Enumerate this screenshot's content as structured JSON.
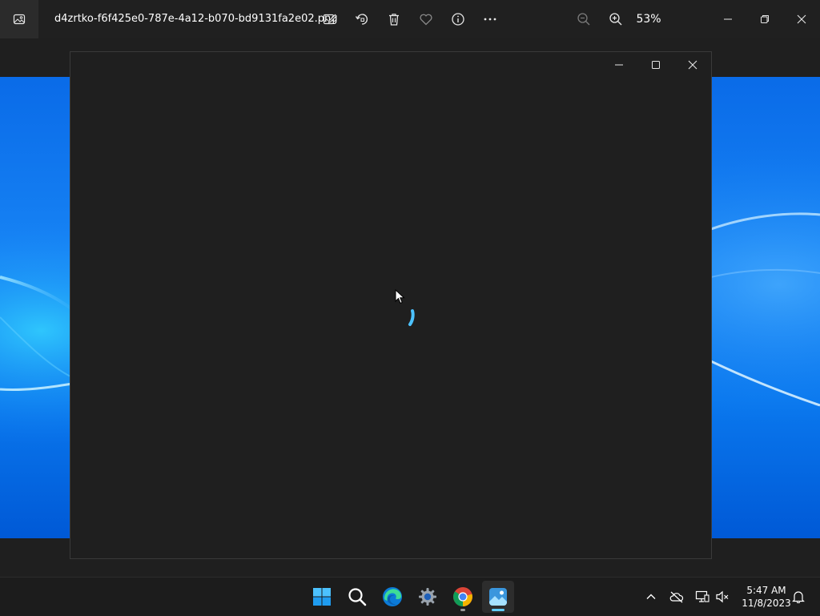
{
  "titlebar": {
    "file_name": "d4zrtko-f6f425e0-787e-4a12-b070-bd9131fa2e02.png",
    "zoom_level": "53%",
    "icons": [
      "photos-app-icon",
      "edit-image-icon",
      "rotate-icon",
      "delete-icon",
      "favorite-icon",
      "info-icon",
      "more-options-icon",
      "zoom-out-icon",
      "zoom-in-icon",
      "minimize-icon",
      "restore-icon",
      "close-icon"
    ]
  },
  "loading_window": {
    "icons": [
      "minimize-icon",
      "maximize-icon",
      "close-icon",
      "loading-spinner-icon"
    ]
  },
  "taskbar": {
    "apps": [
      "start-icon",
      "search-icon",
      "edge-icon",
      "settings-icon",
      "chrome-icon",
      "photos-icon"
    ],
    "tray_icons": [
      "chevron-up-icon",
      "onedrive-offline-icon",
      "network-icon",
      "volume-muted-icon",
      "notifications-icon"
    ],
    "clock": {
      "time": "5:47 AM",
      "date": "11/8/2023"
    }
  },
  "colors": {
    "accent": "#60cdff",
    "spinner": "#4cc2ff",
    "wallpaper_blue": "#0a78ee",
    "surface": "#1f1f1f"
  }
}
